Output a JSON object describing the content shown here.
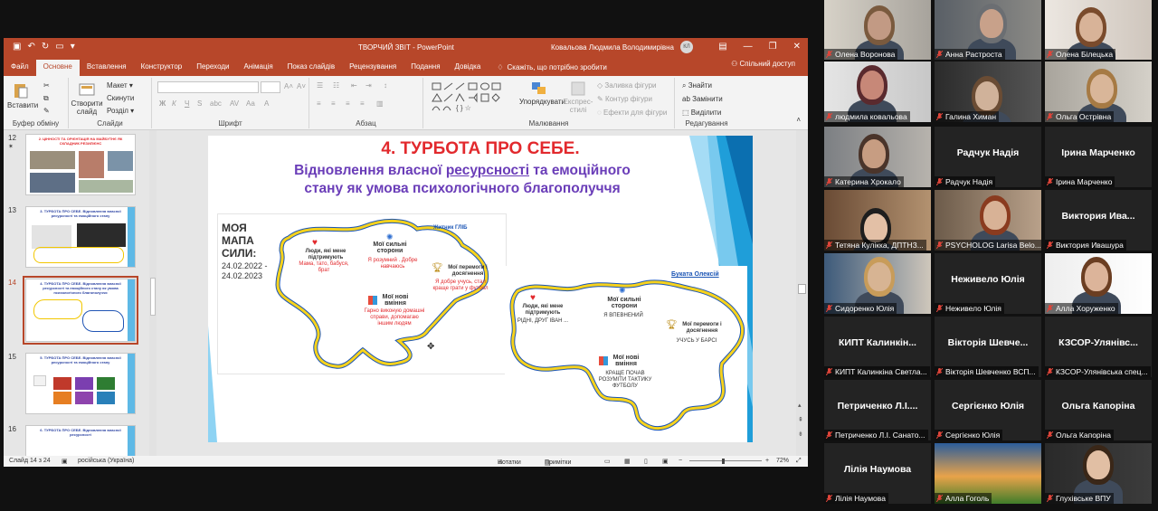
{
  "ppt": {
    "title": "ТВОРЧИЙ ЗВІТ  -  PowerPoint",
    "user": "Ковальова Людмила Володимирівна",
    "user_initials": "КЛ",
    "tabs": [
      "Файл",
      "Основне",
      "Вставлення",
      "Конструктор",
      "Переходи",
      "Анімація",
      "Показ слайдів",
      "Рецензування",
      "Подання",
      "Довідка"
    ],
    "active_tab": "Основне",
    "tell_me": "Скажіть, що потрібно зробити",
    "share": "Спільний доступ",
    "ribbon": {
      "paste": "Вставити",
      "clipboard": "Буфер обміну",
      "new_slide": "Створити слайд",
      "layout": "Макет",
      "reset": "Скинути",
      "section": "Розділ",
      "slides": "Слайди",
      "font": "Шрифт",
      "paragraph": "Абзац",
      "arrange": "Упорядкувати",
      "quick_styles": "Експрес-стилі",
      "shape_fill": "Заливка фігури",
      "shape_outline": "Контур фігури",
      "shape_effects": "Ефекти для фігури",
      "drawing": "Малювання",
      "find": "Знайти",
      "replace": "Замінити",
      "select": "Виділити",
      "editing": "Редагування"
    },
    "thumbs": [
      {
        "num": "12",
        "title": "2. ЦІННОСТІ ТА ОРІЄНТАЦІЯ НА МАЙБУТНЄ ЯК СКЛАДНИК РЕЗИЛІЄНС"
      },
      {
        "num": "13",
        "title": "3. ТУРБОТА ПРО СЕБЕ. Відновлення власної ресурсності та емоційного стану"
      },
      {
        "num": "14",
        "title": "4. ТУРБОТА ПРО СЕБЕ. Відновлення власної ресурсності та емоційного стану як умова психологічного благополуччя"
      },
      {
        "num": "15",
        "title": "5. ТУРБОТА ПРО СЕБЕ. Відновлення власної ресурсності та емоційного стану"
      },
      {
        "num": "16",
        "title": "6. ТУРБОТА ПРО СЕБЕ. Відновлення власної ресурсності"
      }
    ],
    "slide": {
      "heading": "4. ТУРБОТА ПРО СЕБЕ.",
      "sub_a": "Відновлення власної ",
      "sub_b": "ресурсності",
      "sub_c": " та емоційного",
      "sub_line2": "стану як умова психологічного благополуччя",
      "map1": {
        "title1": "МОЯ",
        "title2": "МАПА",
        "title3": "СИЛИ:",
        "dates": "24.02.2022 -",
        "dates2": "24.02.2023",
        "author": "Житник ГЛІБ",
        "support_h": "Люди, які мене підтримують",
        "support_v": "Мама, тато, бабуся, брат",
        "strong_h": "Мої сильні сторони",
        "strong_v": "Я розумний . Добре навчаюсь",
        "wins_h": "Мої перемоги і досягнення",
        "wins_v": "Я добре учусь, стал краще грати у футбол",
        "skills_h": "Мої нові вміння",
        "skills_v": "Гарно виконую домашні справи, допомагаю іншим людям"
      },
      "map2": {
        "author": "Буката Олексій",
        "support_h": "Люди, які мене підтримують",
        "support_v": "РІДНІ, ДРУГ ІВАН ...",
        "strong_h": "Мої сильні сторони",
        "strong_v": "Я ВПЕВНЕНИЙ",
        "wins_h": "Мої перемоги і досягнення",
        "wins_v": "УЧУСЬ У БАРСІ",
        "skills_h": "Мої нові вміння",
        "skills_v": "КРАЩЕ ПОЧАВ РОЗУМІТИ ТАКТИКУ ФУТБОЛУ"
      }
    },
    "status": {
      "slide_of": "Слайд 14 з 24",
      "lang": "російська (Україна)",
      "notes": "Нотатки",
      "comments": "Примітки",
      "zoom": "72%"
    }
  },
  "participants": [
    {
      "name": "Олена Воронова",
      "big": ""
    },
    {
      "name": "Анна Растроста",
      "big": ""
    },
    {
      "name": "Олена Білецька",
      "big": ""
    },
    {
      "name": "людмила ковальова",
      "big": ""
    },
    {
      "name": "Галина Химан",
      "big": ""
    },
    {
      "name": "Ольга Острівна",
      "big": ""
    },
    {
      "name": "Катерина Хрокало",
      "big": ""
    },
    {
      "name": "Радчук Надія",
      "big": "Радчук Надія"
    },
    {
      "name": "Ірина Марченко",
      "big": "Ірина Марченко"
    },
    {
      "name": "Тетяна Кулікка, ДПТНЗ...",
      "big": ""
    },
    {
      "name": "PSYCHOLOG Larisa Belo...",
      "big": ""
    },
    {
      "name": "Виктория Ивашура",
      "big": "Виктория  Ива..."
    },
    {
      "name": "Сидоренко Юлія",
      "big": ""
    },
    {
      "name": "Неживело Юлія",
      "big": "Неживело Юлія"
    },
    {
      "name": "Алла Хоруженко",
      "big": ""
    },
    {
      "name": "КИПТ Калинкіна Светла...",
      "big": "КИПТ  Калинкін..."
    },
    {
      "name": "Вікторія Шевченко ВСП...",
      "big": "Вікторія  Шевче..."
    },
    {
      "name": "КЗСОР-Улянівська спец...",
      "big": "КЗСОР-Улянівс..."
    },
    {
      "name": "Петриченко Л.І. Санато...",
      "big": "Петриченко  Л.І...."
    },
    {
      "name": "Сергієнко Юлія",
      "big": "Сергієнко Юлія"
    },
    {
      "name": "Ольга Капоріна",
      "big": "Ольга Капоріна"
    },
    {
      "name": "Лілія Наумова",
      "big": "Лілія Наумова"
    },
    {
      "name": "Алла Гоголь",
      "big": ""
    },
    {
      "name": "Глухівське ВПУ",
      "big": ""
    }
  ],
  "colors": {
    "ppt_accent": "#b7472a",
    "slide_red": "#e2292d",
    "slide_purple": "#6a3db8",
    "active_speaker": "#c6d72a",
    "map_blue": "#1b55b5",
    "map_yellow": "#f7d21c"
  }
}
